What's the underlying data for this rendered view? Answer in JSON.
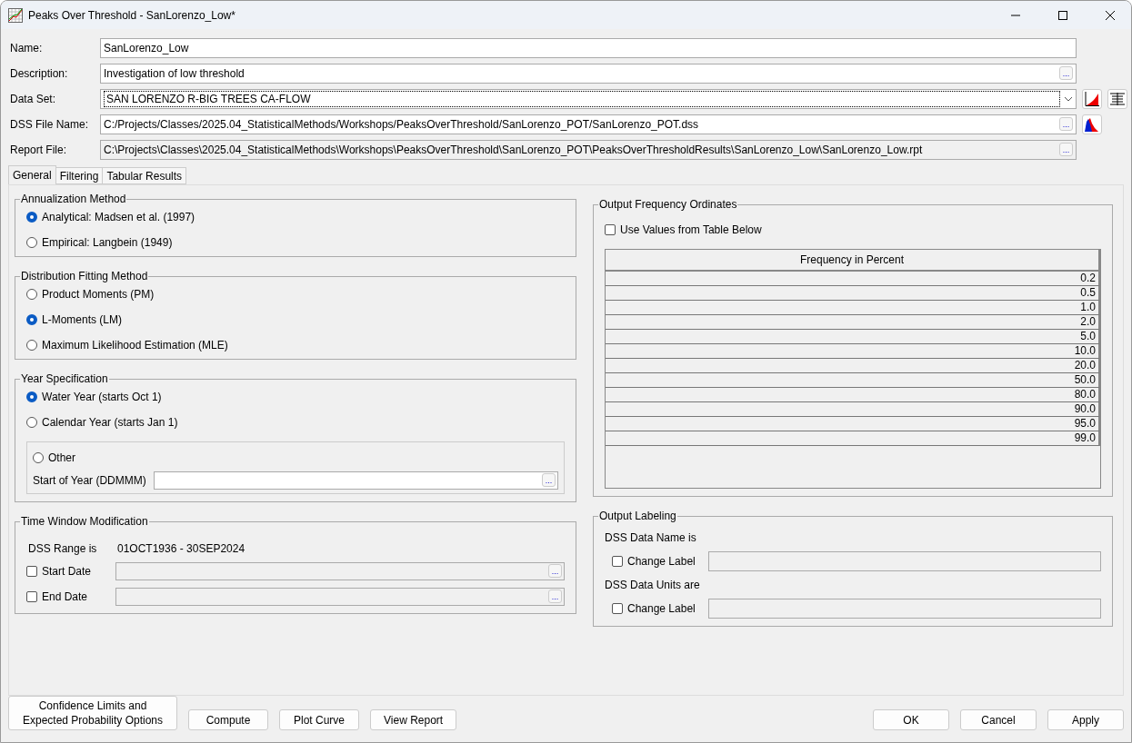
{
  "window": {
    "title": "Peaks Over Threshold - SanLorenzo_Low*"
  },
  "fields": [
    {
      "label": "Name:",
      "value": "SanLorenzo_Low",
      "kind": "text"
    },
    {
      "label": "Description:",
      "value": "Investigation of low threshold",
      "kind": "browse",
      "browse": "..."
    },
    {
      "label": "Data Set:",
      "value": "SAN LORENZO R-BIG TREES CA-FLOW",
      "kind": "combo"
    },
    {
      "label": "DSS File Name:",
      "value": "C:/Projects/Classes/2025.04_StatisticalMethods/Workshops/PeaksOverThreshold/SanLorenzo_POT/SanLorenzo_POT.dss",
      "kind": "browse",
      "browse": "..."
    },
    {
      "label": "Report File:",
      "value": "C:\\Projects\\Classes\\2025.04_StatisticalMethods\\Workshops\\PeaksOverThreshold\\SanLorenzo_POT\\PeaksOverThresholdResults\\SanLorenzo_Low\\SanLorenzo_Low.rpt",
      "kind": "readonly",
      "browse": "..."
    }
  ],
  "tabs": [
    {
      "label": "General",
      "selected": true
    },
    {
      "label": "Filtering",
      "selected": false
    },
    {
      "label": "Tabular Results",
      "selected": false
    }
  ],
  "annualization": {
    "title": "Annualization Method",
    "options": [
      {
        "label": "Analytical: Madsen et al. (1997)",
        "selected": true
      },
      {
        "label": "Empirical: Langbein (1949)",
        "selected": false
      }
    ]
  },
  "distribution": {
    "title": "Distribution Fitting Method",
    "options": [
      {
        "label": "Product Moments (PM)",
        "selected": false
      },
      {
        "label": "L-Moments (LM)",
        "selected": true
      },
      {
        "label": "Maximum Likelihood Estimation (MLE)",
        "selected": false
      }
    ]
  },
  "year_spec": {
    "title": "Year Specification",
    "options": [
      {
        "label": "Water Year (starts Oct 1)",
        "selected": true
      },
      {
        "label": "Calendar Year (starts Jan 1)",
        "selected": false
      }
    ],
    "other": {
      "label": "Other",
      "selected": false
    },
    "start_label": "Start of Year (DDMMM)",
    "start_browse": "..."
  },
  "time_window": {
    "title": "Time Window Modification",
    "range_label": "DSS Range is",
    "range_value": "01OCT1936 - 30SEP2024",
    "dates": [
      {
        "label": "Start Date",
        "checked": false,
        "browse": "..."
      },
      {
        "label": "End Date",
        "checked": false,
        "browse": "..."
      }
    ]
  },
  "output_freq": {
    "title": "Output Frequency Ordinates",
    "use_values": {
      "label": "Use Values from Table Below",
      "checked": false
    },
    "column": "Frequency in Percent",
    "rows": [
      "0.2",
      "0.5",
      "1.0",
      "2.0",
      "5.0",
      "10.0",
      "20.0",
      "50.0",
      "80.0",
      "90.0",
      "95.0",
      "99.0"
    ]
  },
  "output_labeling": {
    "title": "Output Labeling",
    "items": [
      {
        "label": "DSS Data Name is",
        "change": {
          "label": "Change Label",
          "checked": false
        }
      },
      {
        "label": "DSS Data Units are",
        "change": {
          "label": "Change Label",
          "checked": false
        }
      }
    ]
  },
  "buttons_left": [
    "Confidence Limits and Expected Probability Options",
    "Compute",
    "Plot Curve",
    "View Report"
  ],
  "buttons_right": [
    "OK",
    "Cancel",
    "Apply"
  ]
}
